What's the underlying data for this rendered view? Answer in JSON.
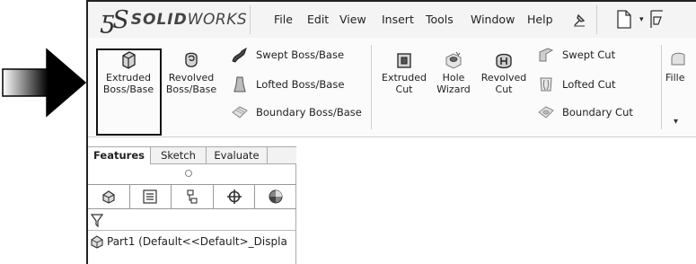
{
  "app": {
    "logo_mark": "ƽS",
    "logo_solid": "SOLID",
    "logo_works": "WORKS"
  },
  "menu": [
    "File",
    "Edit",
    "View",
    "Insert",
    "Tools",
    "Window",
    "Help"
  ],
  "ribbon": {
    "extruded_boss": [
      "Extruded",
      "Boss/Base"
    ],
    "revolved_boss": [
      "Revolved",
      "Boss/Base"
    ],
    "swept_boss": "Swept Boss/Base",
    "lofted_boss": "Lofted Boss/Base",
    "boundary_boss": "Boundary Boss/Base",
    "extruded_cut": [
      "Extruded",
      "Cut"
    ],
    "hole_wizard": [
      "Hole",
      "Wizard"
    ],
    "revolved_cut": [
      "Revolved",
      "Cut"
    ],
    "swept_cut": "Swept Cut",
    "lofted_cut": "Lofted Cut",
    "boundary_cut": "Boundary Cut",
    "fillet": "Fille",
    "overflow": "▾"
  },
  "tabs": [
    {
      "label": "Features",
      "active": true
    },
    {
      "label": "Sketch",
      "active": false
    },
    {
      "label": "Evaluate",
      "active": false
    }
  ],
  "tree": {
    "part_label": "Part1  (Default<<Default>_Displa"
  },
  "colors": {
    "highlight_border": "#111111",
    "arrow_fill_dark": "#000000",
    "arrow_fill_light": "#ffffff"
  }
}
